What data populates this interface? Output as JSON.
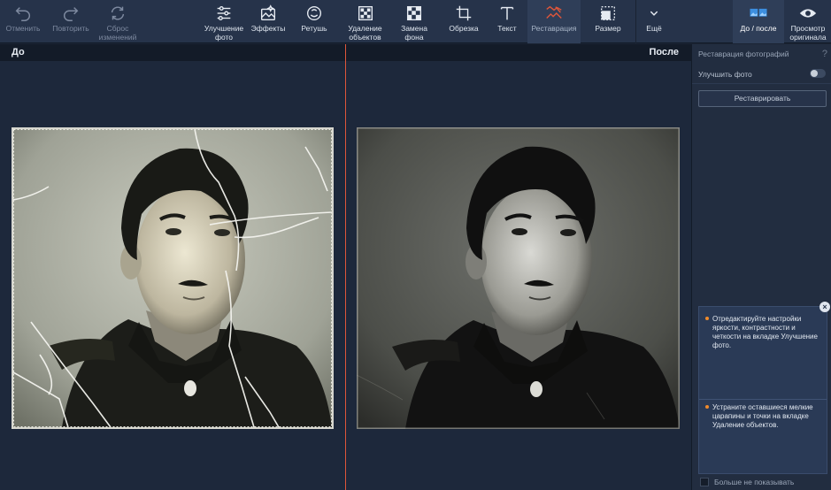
{
  "toolbar": {
    "undo": "Отменить",
    "redo": "Повторить",
    "reset": "Сброс\nизменений",
    "enhance": "Улучшение\nфото",
    "effects": "Эффекты",
    "retouch": "Ретушь",
    "object_removal": "Удаление\nобъектов",
    "bg_replace": "Замена\nфона",
    "crop": "Обрезка",
    "text": "Текст",
    "restoration": "Реставрация",
    "resize": "Размер",
    "more": "Ещё",
    "before_after": "До / после",
    "view_original": "Просмотр\nоригинала"
  },
  "compare": {
    "before": "До",
    "after": "После"
  },
  "panel": {
    "title": "Реставрация фотографий",
    "help": "?",
    "enhance_label": "Улучшить фото",
    "enhance_enabled": false,
    "restore_button": "Реставрировать",
    "tips": [
      "Отредактируйте настройки яркости, контрастности и четкости на вкладке Улучшение фото.",
      "Устраните оставшиеся мелкие царапины и точки на вкладке Удаление объектов."
    ],
    "close": "×",
    "dont_show": "Больше не показывать"
  },
  "colors": {
    "accent": "#e0563a",
    "tip_dot": "#f08a2a",
    "toolbar_bg": "#26334a",
    "canvas_bg": "#1d283b"
  }
}
